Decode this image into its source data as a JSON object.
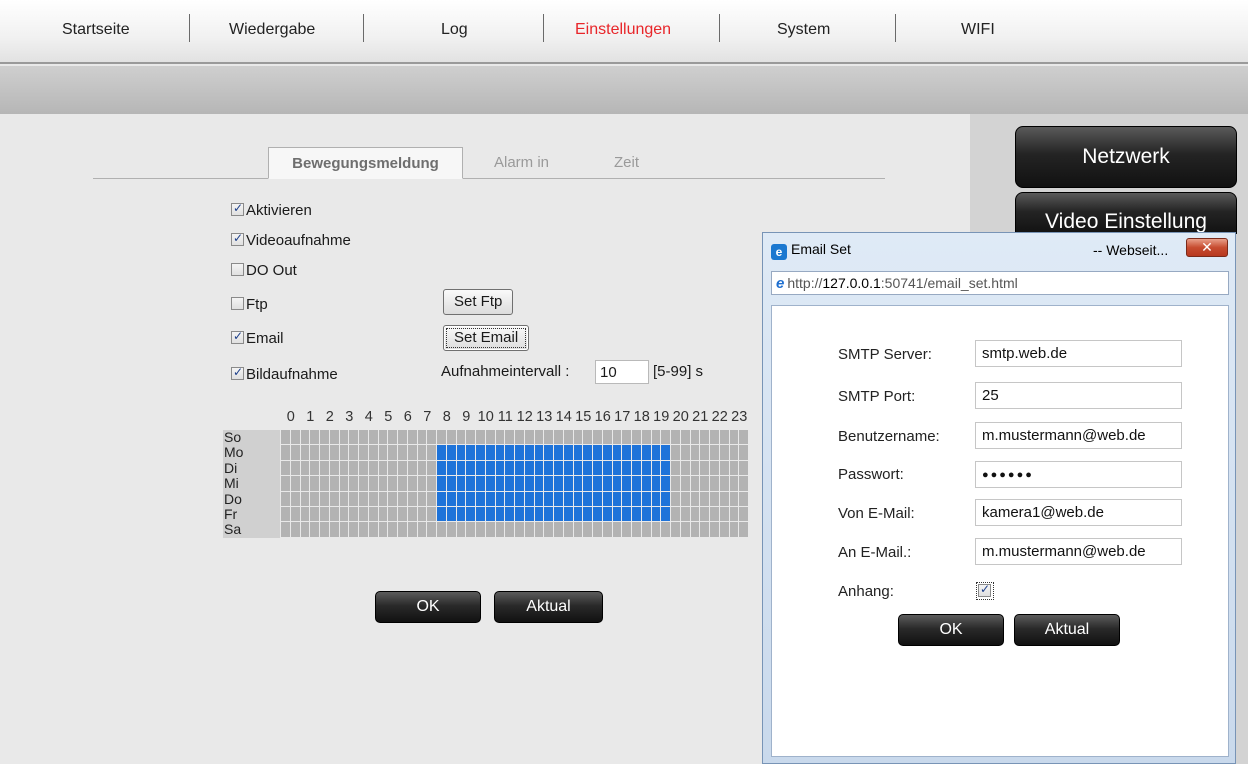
{
  "nav": {
    "items": [
      "Startseite",
      "Wiedergabe",
      "Log",
      "Einstellungen",
      "System",
      "WIFI"
    ],
    "active": "Einstellungen",
    "active_color": "#e8262a"
  },
  "side_menu": [
    "Netzwerk",
    "Video Einstellung"
  ],
  "tabs": [
    "Bewegungsmeldung",
    "Alarm in",
    "Zeit"
  ],
  "options": {
    "aktivieren": {
      "label": "Aktivieren",
      "checked": true
    },
    "video": {
      "label": "Videoaufnahme",
      "checked": true
    },
    "do_out": {
      "label": "DO Out",
      "checked": false
    },
    "ftp": {
      "label": "Ftp",
      "checked": false
    },
    "email": {
      "label": "Email",
      "checked": true
    },
    "bild": {
      "label": "Bildaufnahme",
      "checked": true
    }
  },
  "buttons": {
    "set_ftp": "Set Ftp",
    "set_email": "Set Email",
    "ok": "OK",
    "aktual": "Aktual"
  },
  "interval": {
    "label": "Aufnahmeintervall :",
    "value": "10",
    "range": "[5-99] s"
  },
  "schedule": {
    "hours": [
      "0",
      "1",
      "2",
      "3",
      "4",
      "5",
      "6",
      "7",
      "8",
      "9",
      "10",
      "11",
      "12",
      "13",
      "14",
      "15",
      "16",
      "17",
      "18",
      "19",
      "20",
      "21",
      "22",
      "23"
    ],
    "days": [
      "So",
      "Mo",
      "Di",
      "Mi",
      "Do",
      "Fr",
      "Sa"
    ],
    "active_days": [
      "Mo",
      "Di",
      "Mi",
      "Do",
      "Fr"
    ],
    "active_from_hour": 8,
    "active_to_hour": 19,
    "cells_per_hour": 2,
    "active_color": "#1e73d9",
    "inactive_color": "#b3b3b3"
  },
  "dialog": {
    "title": "Email Set",
    "title_suffix": "-- Webseit...",
    "url_prefix": "http://",
    "url_host": "127.0.0.1",
    "url_rest": ":50741/email_set.html",
    "fields": {
      "smtp_server": {
        "label": "SMTP Server:",
        "value": "smtp.web.de"
      },
      "smtp_port": {
        "label": "SMTP Port:",
        "value": "25"
      },
      "username": {
        "label": "Benutzername:",
        "value": "m.mustermann@web.de"
      },
      "password": {
        "label": "Passwort:",
        "value": "●●●●●●"
      },
      "from": {
        "label": "Von E-Mail:",
        "value": "kamera1@web.de"
      },
      "to": {
        "label": "An E-Mail.:",
        "value": "m.mustermann@web.de"
      },
      "attach": {
        "label": "Anhang:",
        "checked": true
      }
    },
    "ok": "OK",
    "aktual": "Aktual"
  }
}
